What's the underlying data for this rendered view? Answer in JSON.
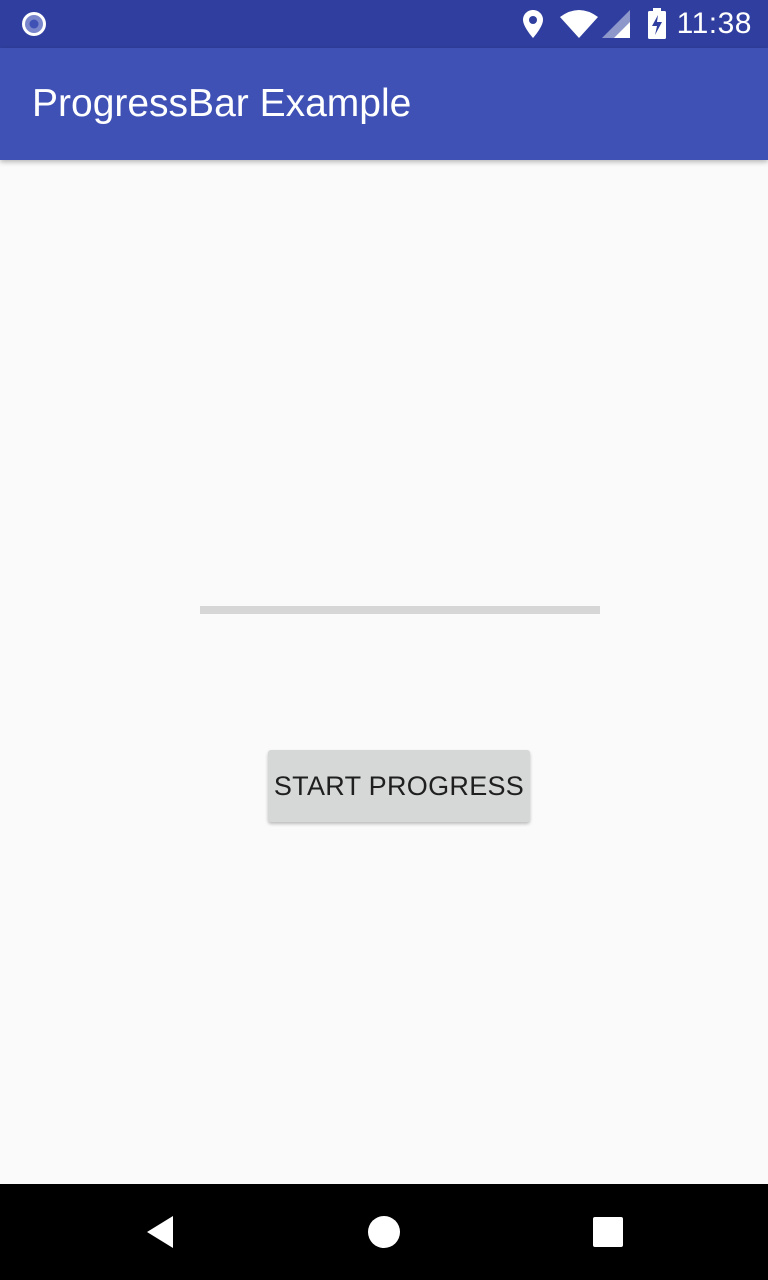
{
  "status_bar": {
    "time": "11:38",
    "icons": [
      "app-indicator-icon",
      "location-icon",
      "wifi-icon",
      "signal-icon",
      "battery-charging-icon"
    ],
    "color": "#303f9f"
  },
  "app_bar": {
    "title": "ProgressBar Example",
    "color": "#3f51b5"
  },
  "main": {
    "progress_bar": {
      "value": 0,
      "track_color": "#d6d6d6"
    },
    "start_button_label": "START PROGRESS"
  },
  "nav_bar": {
    "icons": [
      "back-icon",
      "home-icon",
      "recents-icon"
    ]
  }
}
